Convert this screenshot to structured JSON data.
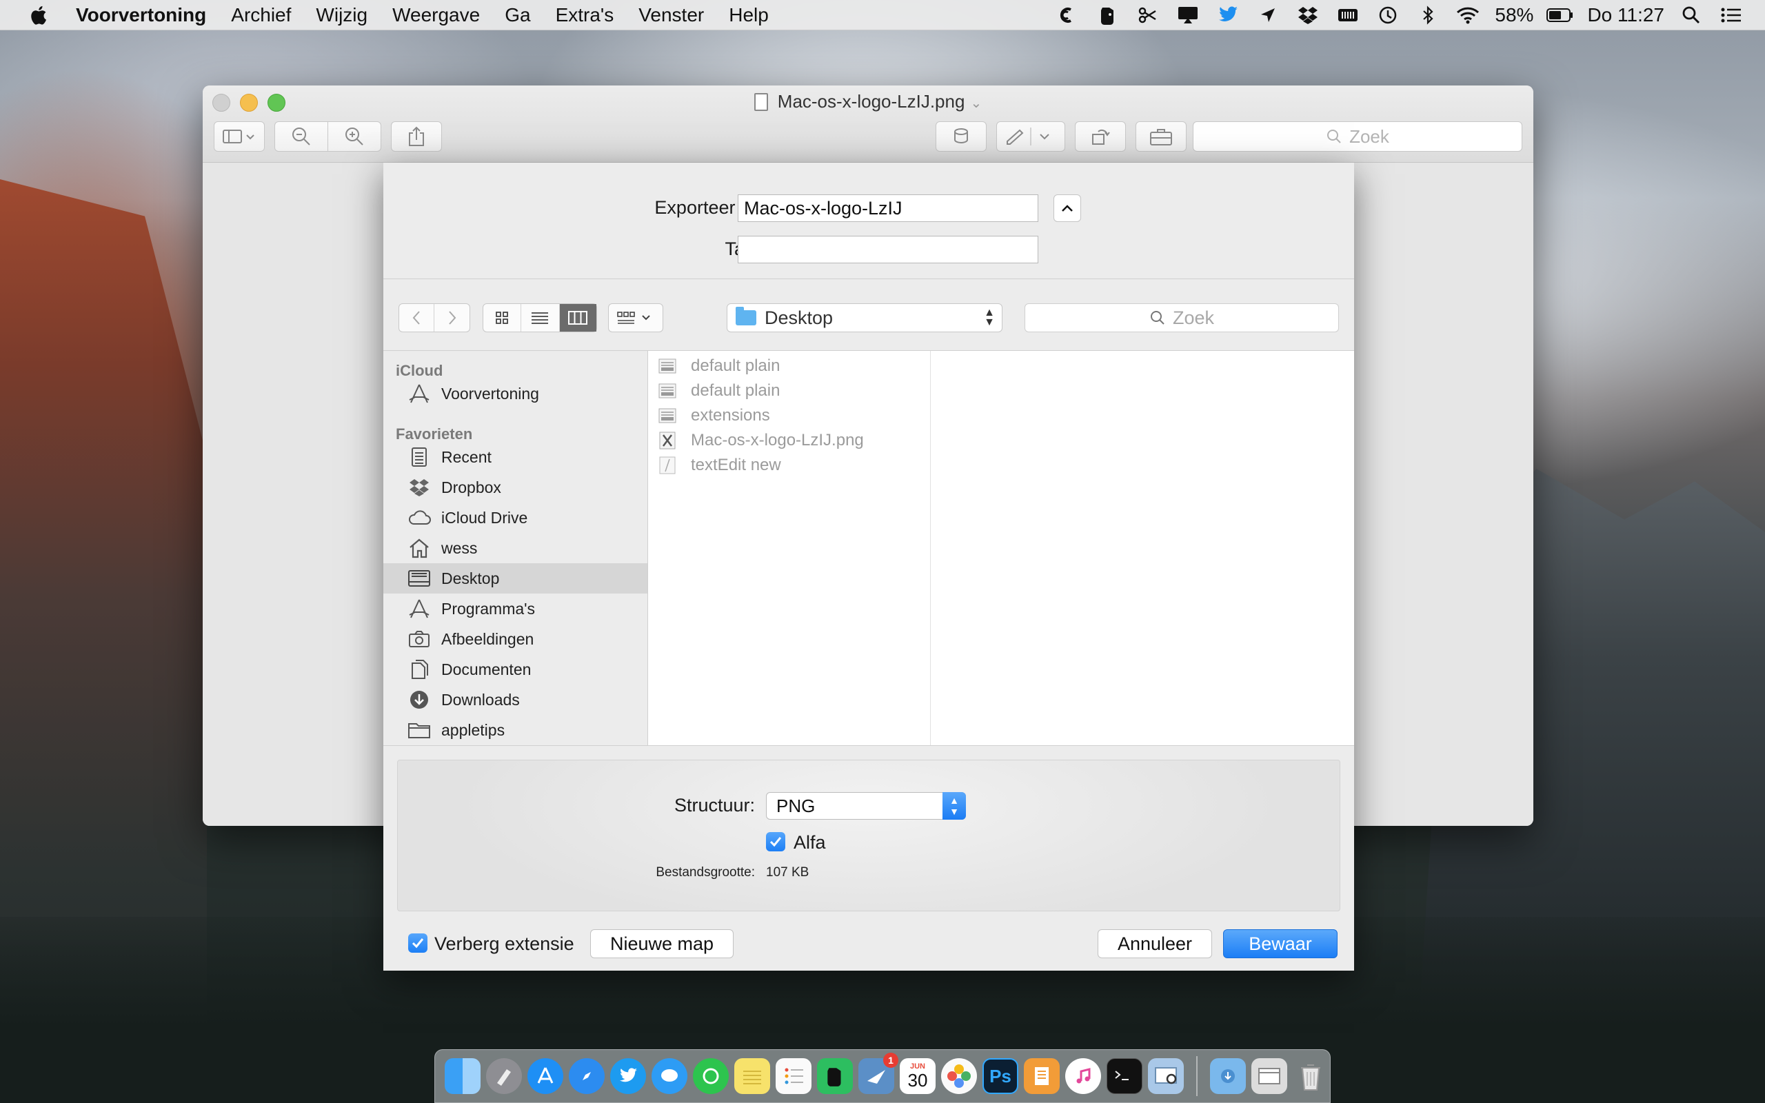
{
  "menubar": {
    "app_name": "Voorvertoning",
    "menus": [
      "Archief",
      "Wijzig",
      "Weergave",
      "Ga",
      "Extra's",
      "Venster",
      "Help"
    ],
    "battery": "58%",
    "clock": "Do 11:27"
  },
  "window": {
    "title": "Mac-os-x-logo-LzIJ.png",
    "search_placeholder": "Zoek"
  },
  "sheet": {
    "export_label": "Exporteer als:",
    "export_value": "Mac-os-x-logo-LzIJ",
    "tags_label": "Tags:",
    "tags_value": "",
    "location": "Desktop",
    "search_placeholder": "Zoek",
    "sidebar": {
      "icloud_header": "iCloud",
      "icloud_items": [
        "Voorvertoning"
      ],
      "favorites_header": "Favorieten",
      "favorites": [
        "Recent",
        "Dropbox",
        "iCloud Drive",
        "wess",
        "Desktop",
        "Programma's",
        "Afbeeldingen",
        "Documenten",
        "Downloads",
        "appletips"
      ],
      "selected": "Desktop"
    },
    "files": [
      "default plain",
      "default plain",
      "extensions",
      "Mac-os-x-logo-LzIJ.png",
      "textEdit new"
    ],
    "format_label": "Structuur:",
    "format_value": "PNG",
    "alpha_label": "Alfa",
    "filesize_label": "Bestandsgrootte:",
    "filesize_value": "107 KB",
    "hide_extension_label": "Verberg extensie",
    "new_folder_label": "Nieuwe map",
    "cancel_label": "Annuleer",
    "save_label": "Bewaar"
  },
  "dock": {
    "calendar_day": "30",
    "calendar_month": "JUN",
    "photoshop_label": "Ps",
    "badge_count": "1"
  },
  "colors": {
    "accent": "#1c7ef5",
    "selection": "#d6d6d6"
  }
}
